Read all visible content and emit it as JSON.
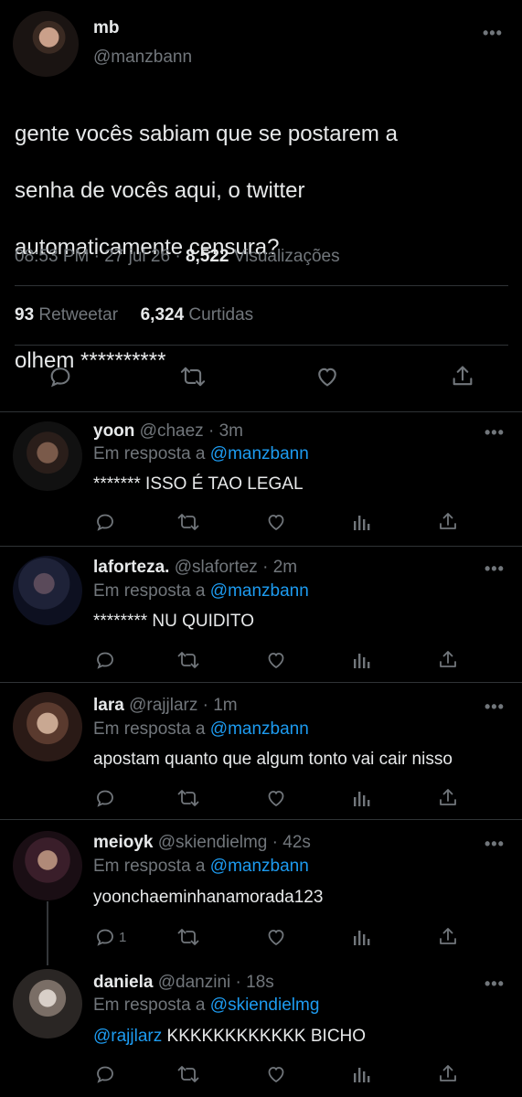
{
  "main_tweet": {
    "display_name": "mb",
    "handle": "@manzbann",
    "text_lines": [
      "gente vocês sabiam que se postarem a",
      "senha de vocês aqui, o twitter",
      "automaticamente censura?",
      "",
      "olhem **********"
    ],
    "time": "08:53 PM",
    "date": "27 jul 26",
    "views_count": "8,522",
    "views_label": "Visualizações",
    "retweets_count": "93",
    "retweets_label": "Retweetar",
    "likes_count": "6,324",
    "likes_label": "Curtidas",
    "more_icon": "more-icon"
  },
  "replies": [
    {
      "name": "yoon",
      "handle": "@chaez",
      "time": "3m",
      "reply_prefix": "Em resposta a",
      "reply_to": "@manzbann",
      "text": "******* ISSO É TAO LEGAL",
      "reply_count": ""
    },
    {
      "name": "laforteza.",
      "handle": "@slafortez",
      "time": "2m",
      "reply_prefix": "Em resposta a",
      "reply_to": "@manzbann",
      "text": "******** NU QUIDITO",
      "reply_count": ""
    },
    {
      "name": "lara",
      "handle": "@rajjlarz",
      "time": "1m",
      "reply_prefix": "Em resposta a",
      "reply_to": "@manzbann",
      "text": "apostam quanto que algum tonto vai cair nisso",
      "reply_count": ""
    },
    {
      "name": "meioyk",
      "handle": "@skiendielmg",
      "time": "42s",
      "reply_prefix": "Em resposta a",
      "reply_to": "@manzbann",
      "text": "yoonchaeminhanamorada123",
      "reply_count": "1"
    },
    {
      "name": "daniela",
      "handle": "@danzini",
      "time": "18s",
      "reply_prefix": "Em resposta a",
      "reply_to": "@skiendielmg",
      "mention": "@rajjlarz",
      "text": " KKKKKKKKKKKK BICHO",
      "reply_count": ""
    }
  ],
  "separator": "·",
  "colors": {
    "background": "#000000",
    "text": "#e7e9ea",
    "muted": "#71767b",
    "link": "#1d9bf0",
    "divider": "#2f3336"
  },
  "icons": [
    "reply-icon",
    "retweet-icon",
    "like-icon",
    "share-icon",
    "views-icon",
    "more-icon"
  ]
}
